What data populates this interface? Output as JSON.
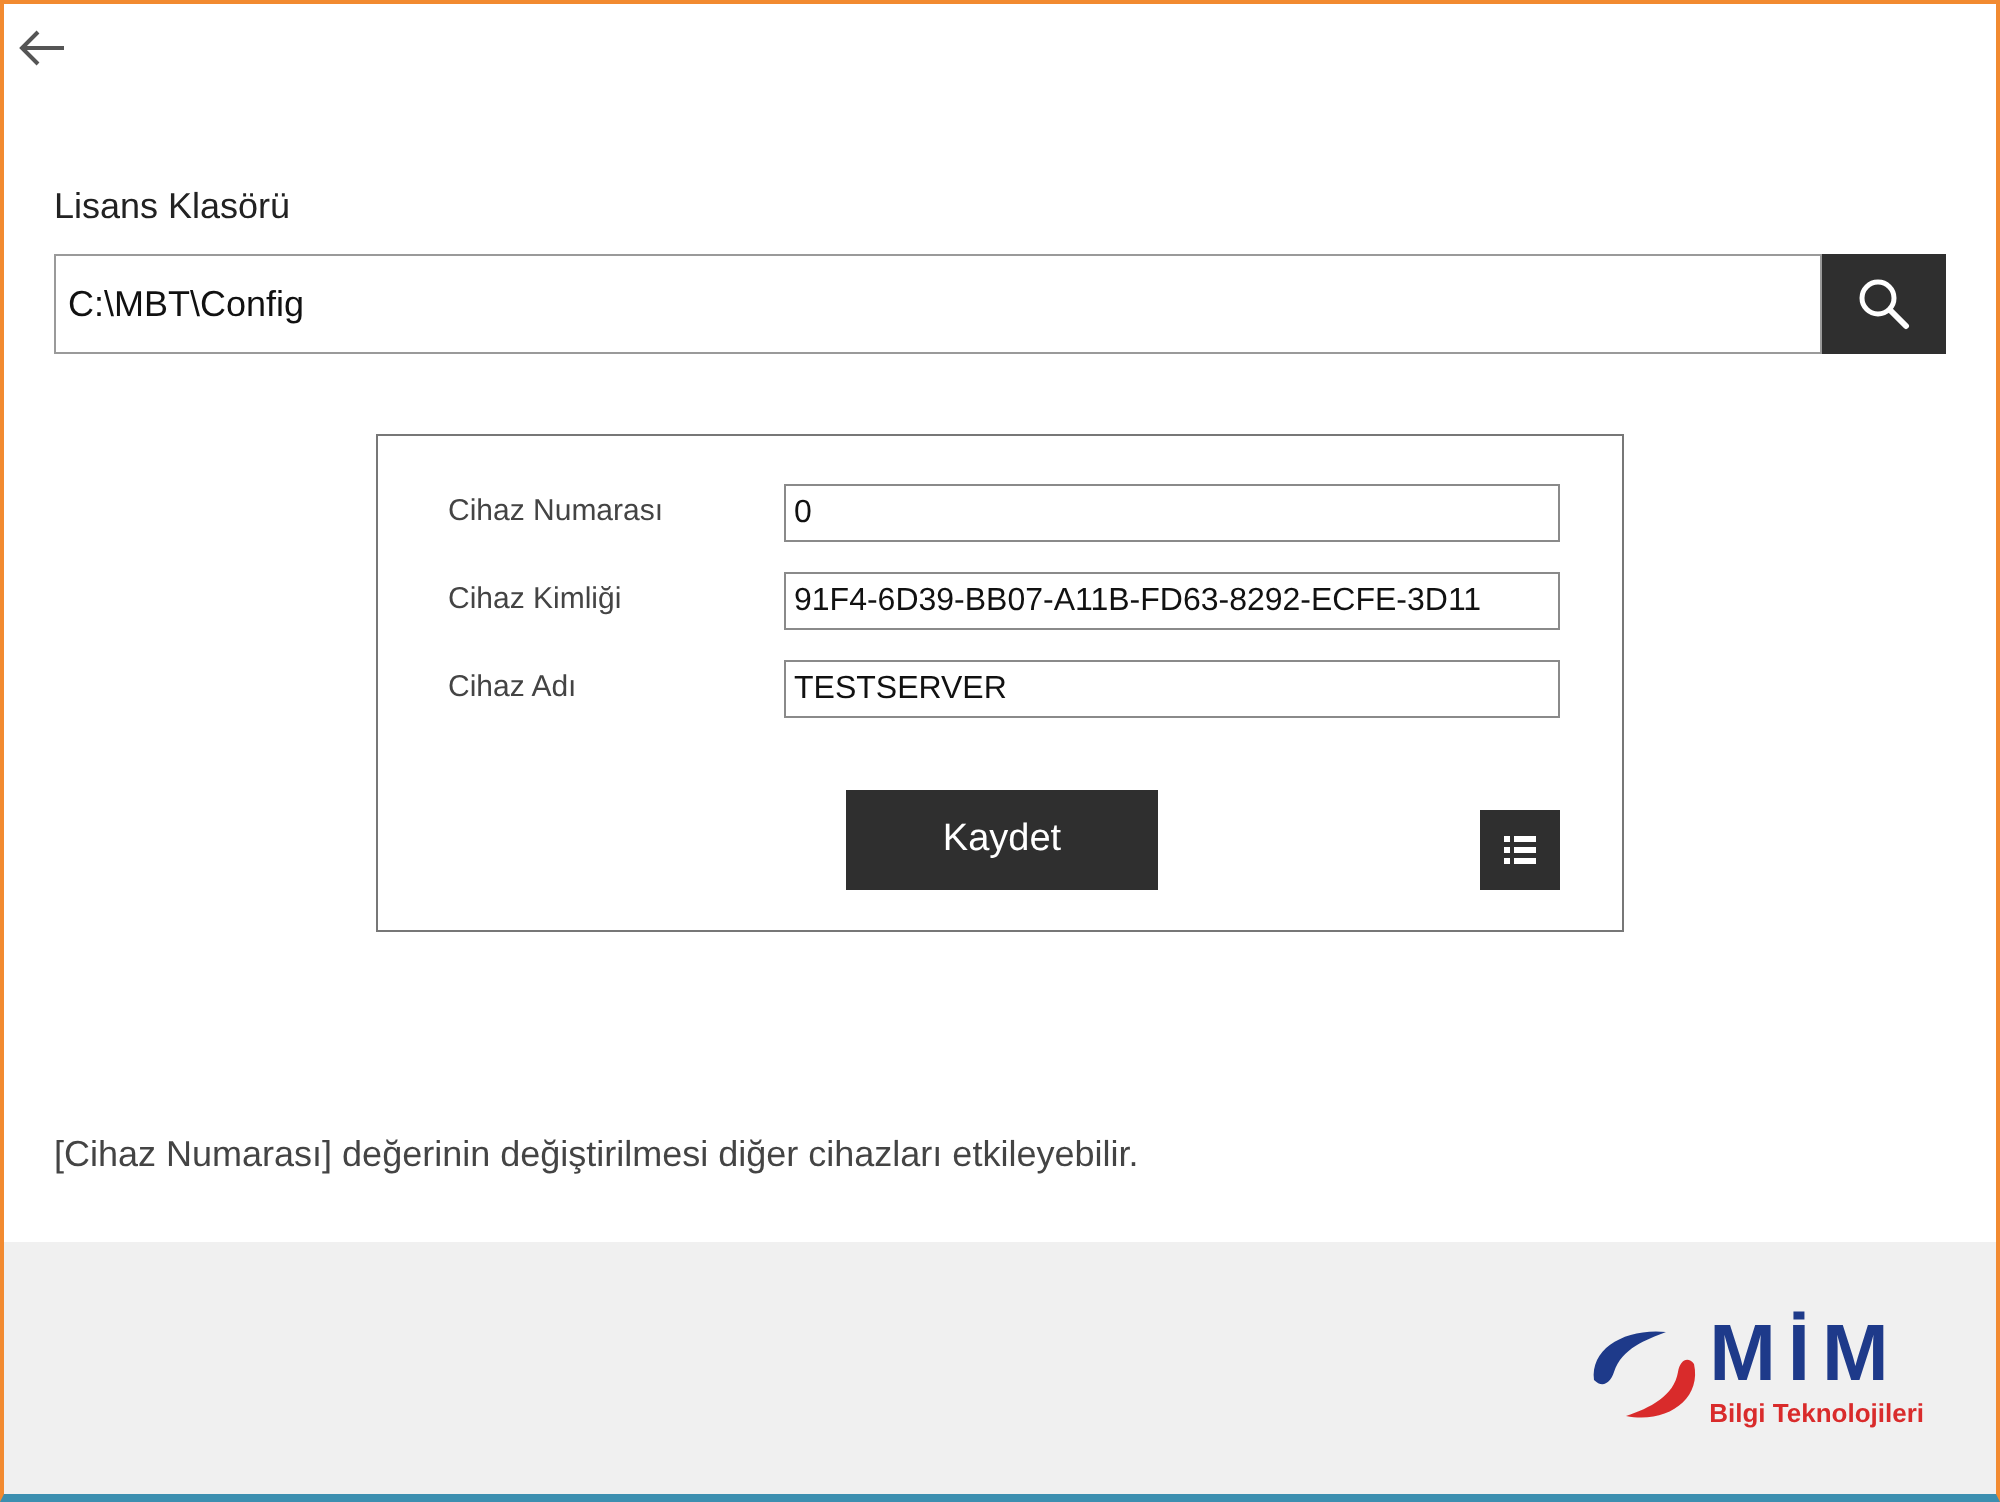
{
  "folder": {
    "label": "Lisans Klasörü",
    "value": "C:\\MBT\\Config"
  },
  "fields": [
    {
      "label": "Cihaz Numarası",
      "value": "0"
    },
    {
      "label": "Cihaz Kimliği",
      "value": "91F4-6D39-BB07-A11B-FD63-8292-ECFE-3D11"
    },
    {
      "label": "Cihaz Adı",
      "value": "TESTSERVER"
    }
  ],
  "save_button": "Kaydet",
  "note": "[Cihaz Numarası] değerinin değiştirilmesi diğer cihazları etkileyebilir.",
  "logo": {
    "name": "MİM",
    "subtitle": "Bilgi Teknolojileri"
  }
}
